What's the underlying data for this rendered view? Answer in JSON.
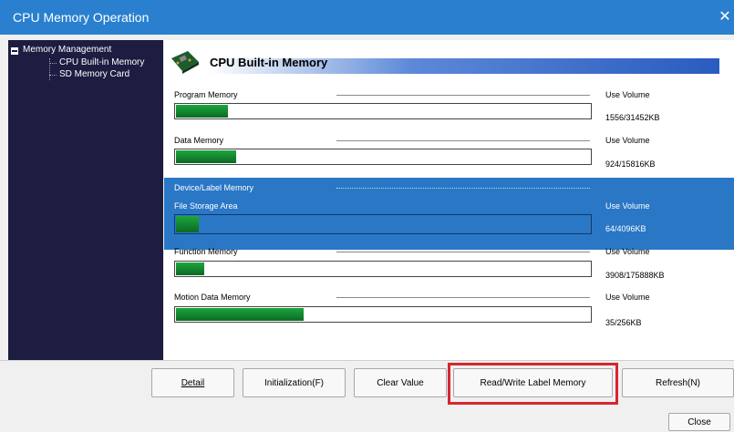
{
  "window": {
    "title": "CPU Memory Operation",
    "close_glyph": "✕"
  },
  "tree": {
    "root_label": "Memory Management",
    "items": [
      {
        "label": "CPU Built-in Memory"
      },
      {
        "label": "SD Memory Card"
      }
    ]
  },
  "header": {
    "title": "CPU Built-in Memory",
    "icon": "memory-chip-icon"
  },
  "memory_rows": [
    {
      "label": "Program Memory",
      "use_label": "Use Volume",
      "value": "1556/31452KB",
      "used": 1556,
      "total": 31452
    },
    {
      "label": "Data Memory",
      "use_label": "Use Volume",
      "value": "924/15816KB",
      "used": 924,
      "total": 15816
    },
    {
      "label": "Function Memory",
      "use_label": "Use Volume",
      "value": "3908/175888KB",
      "used": 3908,
      "total": 175888
    },
    {
      "label": "Motion Data Memory",
      "use_label": "Use Volume",
      "value": "35/256KB",
      "used": 35,
      "total": 256
    }
  ],
  "selected_group": {
    "label": "Device/Label Memory",
    "sub_label": "File Storage Area",
    "use_label": "Use Volume",
    "value": "64/4096KB",
    "used": 64,
    "total": 4096
  },
  "buttons": {
    "detail": "Detail",
    "initialization": "Initialization(F)",
    "clear_value": "Clear Value",
    "read_write_label_memory": "Read/Write Label Memory",
    "refresh": "Refresh(N)",
    "close": "Close"
  },
  "colors": {
    "titlebar": "#2a80cf",
    "tree_bg": "#1d1c41",
    "selection": "#2a77c6",
    "highlight_box": "#d7262e",
    "bar_fill": "#1ea53d"
  }
}
